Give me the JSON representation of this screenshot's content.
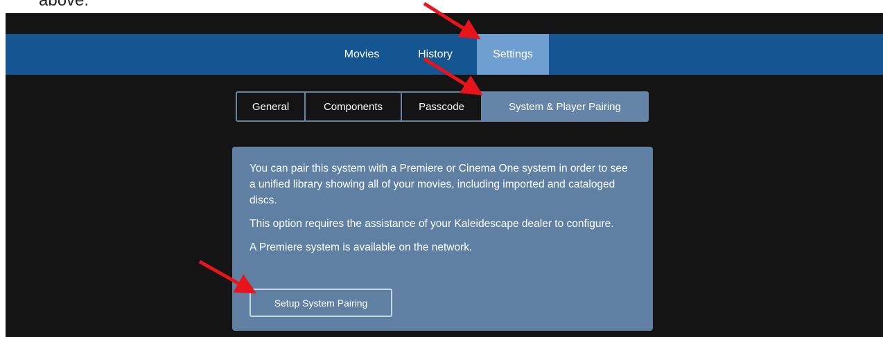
{
  "document_fragment": "above.",
  "navbar": {
    "tabs": [
      {
        "label": "Movies"
      },
      {
        "label": "History"
      },
      {
        "label": "Settings",
        "active": true
      }
    ]
  },
  "settings_tabs": [
    {
      "label": "General"
    },
    {
      "label": "Components"
    },
    {
      "label": "Passcode"
    },
    {
      "label": "System & Player Pairing",
      "active": true
    }
  ],
  "panel": {
    "paragraph1": "You can pair this system with a Premiere or Cinema One system in order to see a unified library showing all of your movies, including imported and cataloged discs.",
    "paragraph2": "This option requires the assistance of your Kaleidescape dealer to configure.",
    "paragraph3": "A Premiere system is available on the network.",
    "button_label": "Setup System Pairing"
  },
  "colors": {
    "navbar": "#155591",
    "active_tab": "#6f9fd0",
    "panel": "#5f80a3",
    "background": "#141414",
    "annotation_arrow": "#e8141b"
  }
}
